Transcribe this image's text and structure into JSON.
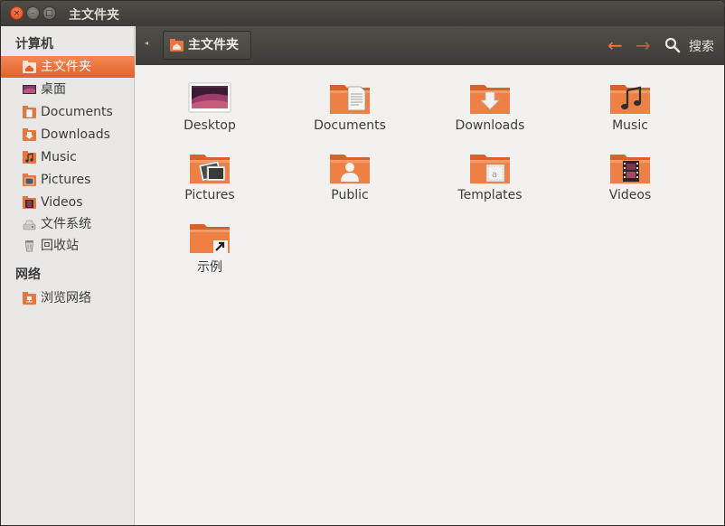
{
  "window": {
    "title": "主文件夹",
    "close_glyph": "×",
    "min_glyph": "–",
    "max_glyph": "□"
  },
  "sidebar": {
    "section_computer": "计算机",
    "section_network": "网络",
    "computer_items": [
      {
        "label": "主文件夹",
        "icon": "home-folder-icon",
        "active": true
      },
      {
        "label": "桌面",
        "icon": "desktop-icon",
        "active": false
      },
      {
        "label": "Documents",
        "icon": "documents-icon",
        "active": false
      },
      {
        "label": "Downloads",
        "icon": "downloads-icon",
        "active": false
      },
      {
        "label": "Music",
        "icon": "music-icon",
        "active": false
      },
      {
        "label": "Pictures",
        "icon": "pictures-icon",
        "active": false
      },
      {
        "label": "Videos",
        "icon": "videos-icon",
        "active": false
      },
      {
        "label": "文件系统",
        "icon": "drive-icon",
        "active": false
      },
      {
        "label": "回收站",
        "icon": "trash-icon",
        "active": false
      }
    ],
    "network_items": [
      {
        "label": "浏览网络",
        "icon": "network-icon",
        "active": false
      }
    ]
  },
  "toolbar": {
    "path_label": "主文件夹",
    "back_glyph": "←",
    "forward_glyph": "→",
    "search_label": "搜索",
    "left_arrow_glyph": "◂"
  },
  "files": [
    {
      "label": "Desktop",
      "icon": "desktop-folder-icon"
    },
    {
      "label": "Documents",
      "icon": "documents-folder-icon"
    },
    {
      "label": "Downloads",
      "icon": "downloads-folder-icon"
    },
    {
      "label": "Music",
      "icon": "music-folder-icon"
    },
    {
      "label": "Pictures",
      "icon": "pictures-folder-icon"
    },
    {
      "label": "Public",
      "icon": "public-folder-icon"
    },
    {
      "label": "Templates",
      "icon": "templates-folder-icon"
    },
    {
      "label": "Videos",
      "icon": "videos-folder-icon"
    },
    {
      "label": "示例",
      "icon": "examples-folder-icon"
    }
  ],
  "colors": {
    "accent": "#e45f27",
    "folder": "#e8753d",
    "titlebar": "#3c3b37",
    "sidebar_bg": "#e9e8e6"
  }
}
